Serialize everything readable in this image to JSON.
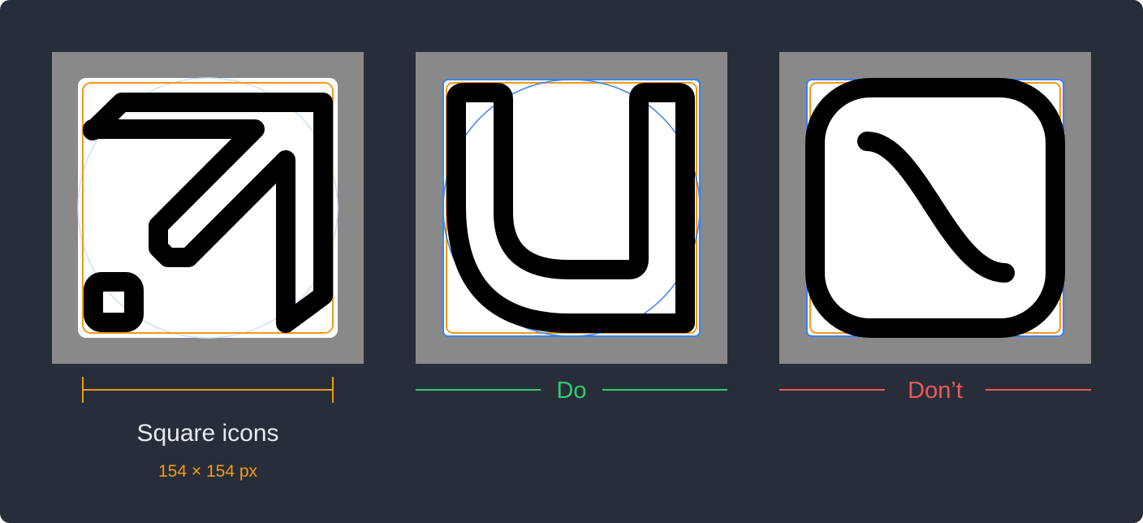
{
  "colors": {
    "background": "#282e39",
    "tile": "#898989",
    "canvas": "#ffffff",
    "keyline_orange": "#f09a1a",
    "keyline_blue": "#3b82f6",
    "keyline_light": "#cfe0f2",
    "stroke": "#000000",
    "do_green": "#2ecc71",
    "dont_red": "#f0585a",
    "caption_text": "#e6e9ef",
    "dims_text": "#f09a1a"
  },
  "examples": [
    {
      "id": "square-icon-example",
      "icon": "arrow-up-right-icon"
    },
    {
      "id": "do-example",
      "icon": "u-shape-icon"
    },
    {
      "id": "dont-example",
      "icon": "sine-wave-in-rounded-square-icon"
    }
  ],
  "labels": {
    "do": "Do",
    "dont": "Don’t",
    "caption": "Square icons",
    "dimensions": "154 × 154 px"
  }
}
